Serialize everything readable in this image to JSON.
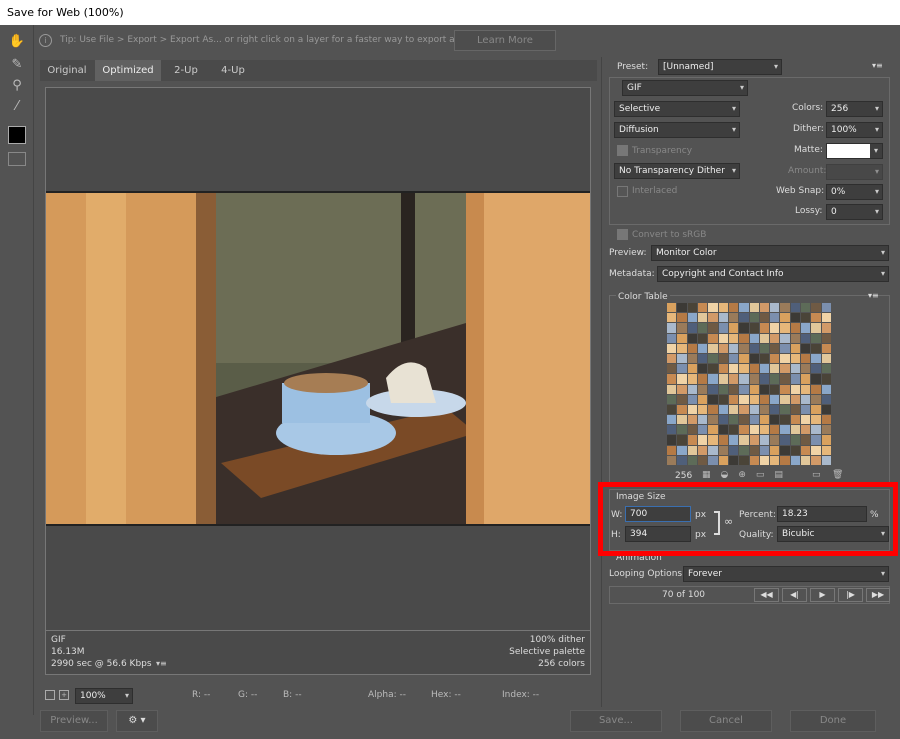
{
  "window": {
    "title": "Save for Web (100%)"
  },
  "tip": {
    "text": "Tip: Use File > Export > Export As...  or right click on a layer for a faster way to export assets",
    "button": "Learn More"
  },
  "tabs": [
    "Original",
    "Optimized",
    "2-Up",
    "4-Up"
  ],
  "info_left": [
    "GIF",
    "16.13M",
    "2990 sec @ 56.6 Kbps"
  ],
  "info_right": [
    "100% dither",
    "Selective palette",
    "256 colors"
  ],
  "statusbar": {
    "zoom": "100%",
    "r": "R: --",
    "g": "G: --",
    "b": "B: --",
    "alpha": "Alpha: --",
    "hex": "Hex: --",
    "index": "Index: --"
  },
  "buttons": {
    "preview": "Preview...",
    "save": "Save...",
    "cancel": "Cancel",
    "done": "Done"
  },
  "settings": {
    "preset_label": "Preset:",
    "preset_value": "[Unnamed]",
    "format": "GIF",
    "reduction": "Selective",
    "dither_algo": "Diffusion",
    "transparency": "Transparency",
    "trans_dither": "No Transparency Dither",
    "interlaced": "Interlaced",
    "colors_label": "Colors:",
    "colors_value": "256",
    "dither_label": "Dither:",
    "dither_value": "100%",
    "matte_label": "Matte:",
    "amount_label": "Amount:",
    "websnap_label": "Web Snap:",
    "websnap_value": "0%",
    "lossy_label": "Lossy:",
    "lossy_value": "0",
    "convert_srgb": "Convert to sRGB",
    "preview_label": "Preview:",
    "preview_value": "Monitor Color",
    "metadata_label": "Metadata:",
    "metadata_value": "Copyright and Contact Info"
  },
  "color_table": {
    "title": "Color Table",
    "count": "256"
  },
  "image_size": {
    "title": "Image Size",
    "w_label": "W:",
    "w_value": "700",
    "h_label": "H:",
    "h_value": "394",
    "unit": "px",
    "percent_label": "Percent:",
    "percent_value": "18.23",
    "percent_unit": "%",
    "quality_label": "Quality:",
    "quality_value": "Bicubic"
  },
  "animation": {
    "title": "Animation",
    "looping_label": "Looping Options:",
    "looping_value": "Forever",
    "frame": "70 of 100"
  },
  "colors": {
    "highlight": "#ff0000",
    "panel_bg": "#535353",
    "field_bg": "#3e3e3e"
  }
}
